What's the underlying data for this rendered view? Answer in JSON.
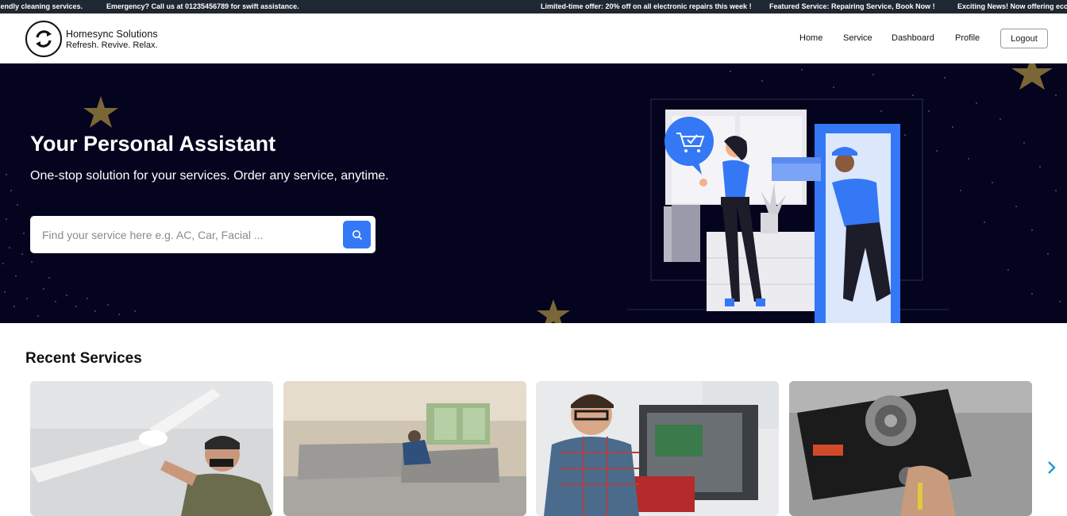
{
  "ticker": {
    "items": [
      "iendly cleaning services.",
      "Emergency? Call us at 01235456789 for swift assistance.",
      "Limited-time offer: 20% off on all electronic repairs this week !",
      "Featured Service: Repairing Service, Book Now !",
      "Exciting News! Now offering eco-"
    ]
  },
  "header": {
    "brand_name": "Homesync Solutions",
    "brand_tagline": "Refresh. Revive. Relax.",
    "nav": [
      "Home",
      "Service",
      "Dashboard",
      "Profile"
    ],
    "logout_label": "Logout"
  },
  "hero": {
    "title": "Your Personal Assistant",
    "subtitle": "One-stop solution for your services. Order any service, anytime.",
    "search_placeholder": "Find your service here e.g. AC, Car, Facial ..."
  },
  "recent": {
    "title": "Recent Services",
    "cards": [
      "ceiling-fan-repair-image",
      "sofa-cleaning-image",
      "computer-repair-image",
      "gas-stove-repair-image"
    ]
  },
  "colors": {
    "ticker_bg": "#1f2732",
    "hero_bg": "#04041e",
    "accent": "#3478f6",
    "star": "#7a6636"
  }
}
